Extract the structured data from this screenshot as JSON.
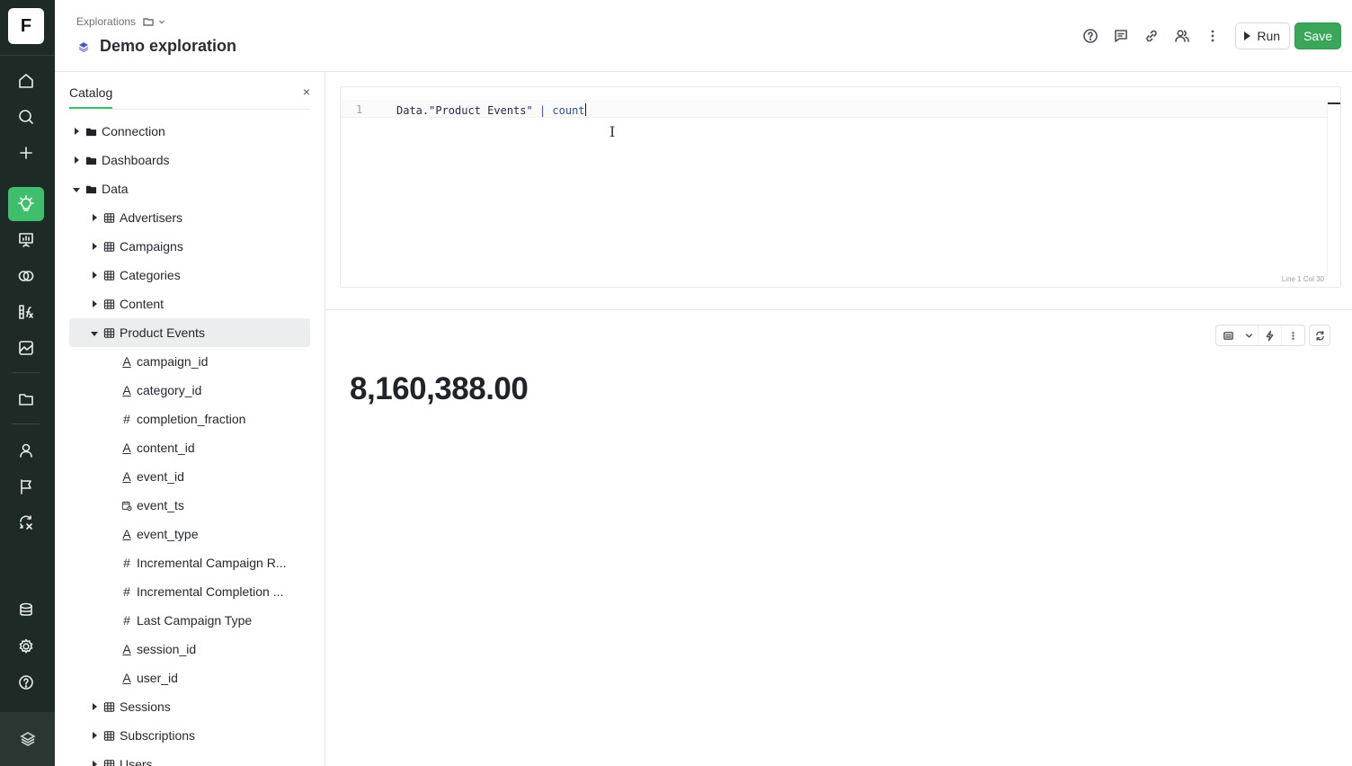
{
  "app": {
    "logo_letter": "F",
    "accent_color": "#3fbf6b",
    "save_color": "#3aa65a",
    "rail_bg": "#1e2a26"
  },
  "rail": {
    "icons": [
      "home-icon",
      "search-icon",
      "plus-icon",
      "lightbulb-icon",
      "presentation-icon",
      "venn-icon",
      "function-icon",
      "image-chart-icon",
      "folder-icon",
      "user-icon",
      "flag-icon",
      "sync-icon",
      "database-icon",
      "gear-icon",
      "help-icon",
      "brand-icon"
    ],
    "active": "lightbulb-icon"
  },
  "header": {
    "breadcrumb": "Explorations",
    "title": "Demo exploration",
    "run_label": "Run",
    "save_label": "Save",
    "icons": [
      "help-circle-icon",
      "comment-icon",
      "link-icon",
      "users-icon",
      "more-vertical-icon"
    ]
  },
  "catalog": {
    "title": "Catalog",
    "close": "×",
    "items": [
      {
        "label": "Connection",
        "kind": "folder",
        "level": 0,
        "expanded": false
      },
      {
        "label": "Dashboards",
        "kind": "folder",
        "level": 0,
        "expanded": false
      },
      {
        "label": "Data",
        "kind": "folder",
        "level": 0,
        "expanded": true
      },
      {
        "label": "Advertisers",
        "kind": "table",
        "level": 1,
        "expanded": false
      },
      {
        "label": "Campaigns",
        "kind": "table",
        "level": 1,
        "expanded": false
      },
      {
        "label": "Categories",
        "kind": "table",
        "level": 1,
        "expanded": false
      },
      {
        "label": "Content",
        "kind": "table",
        "level": 1,
        "expanded": false
      },
      {
        "label": "Product Events",
        "kind": "table",
        "level": 1,
        "expanded": true,
        "selected": true
      },
      {
        "label": "campaign_id",
        "kind": "string",
        "level": 2
      },
      {
        "label": "category_id",
        "kind": "string",
        "level": 2
      },
      {
        "label": "completion_fraction",
        "kind": "number",
        "level": 2
      },
      {
        "label": "content_id",
        "kind": "string",
        "level": 2
      },
      {
        "label": "event_id",
        "kind": "string",
        "level": 2
      },
      {
        "label": "event_ts",
        "kind": "datetime",
        "level": 2
      },
      {
        "label": "event_type",
        "kind": "string",
        "level": 2
      },
      {
        "label": "Incremental Campaign R...",
        "kind": "number",
        "level": 2
      },
      {
        "label": "Incremental Completion ...",
        "kind": "number",
        "level": 2
      },
      {
        "label": "Last Campaign Type",
        "kind": "number",
        "level": 2
      },
      {
        "label": "session_id",
        "kind": "string",
        "level": 2
      },
      {
        "label": "user_id",
        "kind": "string",
        "level": 2
      },
      {
        "label": "Sessions",
        "kind": "table",
        "level": 1,
        "expanded": false
      },
      {
        "label": "Subscriptions",
        "kind": "table",
        "level": 1,
        "expanded": false
      },
      {
        "label": "Users",
        "kind": "table",
        "level": 1,
        "expanded": false
      }
    ]
  },
  "editor": {
    "line_number": "1",
    "code_prefix": "Data.",
    "code_string": "\"Product Events\"",
    "code_suffix": " | count",
    "status": "Line 1 Col 30"
  },
  "result": {
    "value": "8,160,388.00",
    "tools": [
      "table-icon",
      "chevron-down-icon",
      "lightning-icon",
      "more-vertical-icon",
      "refresh-icon"
    ]
  }
}
